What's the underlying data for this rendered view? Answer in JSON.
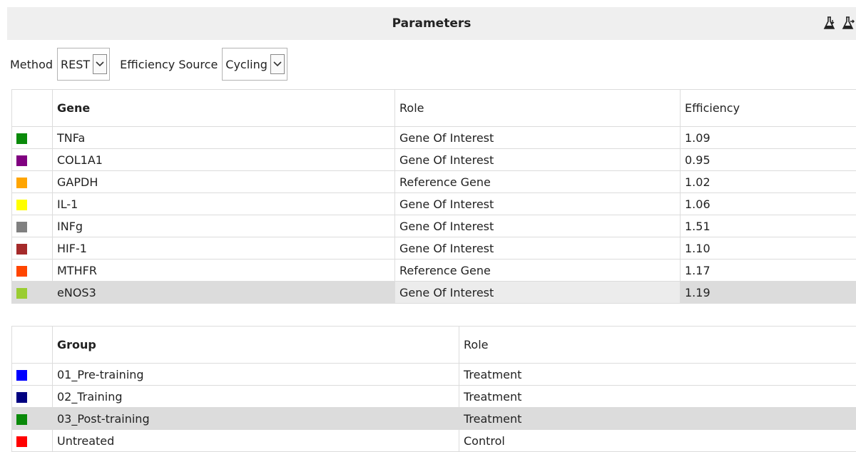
{
  "header": {
    "title": "Parameters",
    "icons": [
      "flask-import-icon",
      "flask-export-icon"
    ]
  },
  "controls": {
    "method_label": "Method",
    "method_value": "REST",
    "efficiency_label": "Efficiency Source",
    "efficiency_value": "Cycling"
  },
  "gene_table": {
    "columns": [
      "Gene",
      "Role",
      "Efficiency"
    ],
    "rows": [
      {
        "color": "#0a8a0a",
        "gene": "TNFa",
        "role": "Gene Of Interest",
        "efficiency": "1.09"
      },
      {
        "color": "#800080",
        "gene": "COL1A1",
        "role": "Gene Of Interest",
        "efficiency": "0.95"
      },
      {
        "color": "#ffa500",
        "gene": "GAPDH",
        "role": "Reference Gene",
        "efficiency": "1.02"
      },
      {
        "color": "#ffff00",
        "gene": "IL-1",
        "role": "Gene Of Interest",
        "efficiency": "1.06"
      },
      {
        "color": "#808080",
        "gene": "INFg",
        "role": "Gene Of Interest",
        "efficiency": "1.51"
      },
      {
        "color": "#a52a2a",
        "gene": "HIF-1",
        "role": "Gene Of Interest",
        "efficiency": "1.10"
      },
      {
        "color": "#ff4500",
        "gene": "MTHFR",
        "role": "Reference Gene",
        "efficiency": "1.17"
      },
      {
        "color": "#9acd32",
        "gene": "eNOS3",
        "role": "Gene Of Interest",
        "efficiency": "1.19",
        "selected": true
      }
    ]
  },
  "group_table": {
    "columns": [
      "Group",
      "Role"
    ],
    "rows": [
      {
        "color": "#0000ff",
        "group": "01_Pre-training",
        "role": "Treatment"
      },
      {
        "color": "#000080",
        "group": "02_Training",
        "role": "Treatment"
      },
      {
        "color": "#0a8a0a",
        "group": "03_Post-training",
        "role": "Treatment",
        "selected": true
      },
      {
        "color": "#ff0000",
        "group": "Untreated",
        "role": "Control"
      }
    ]
  }
}
